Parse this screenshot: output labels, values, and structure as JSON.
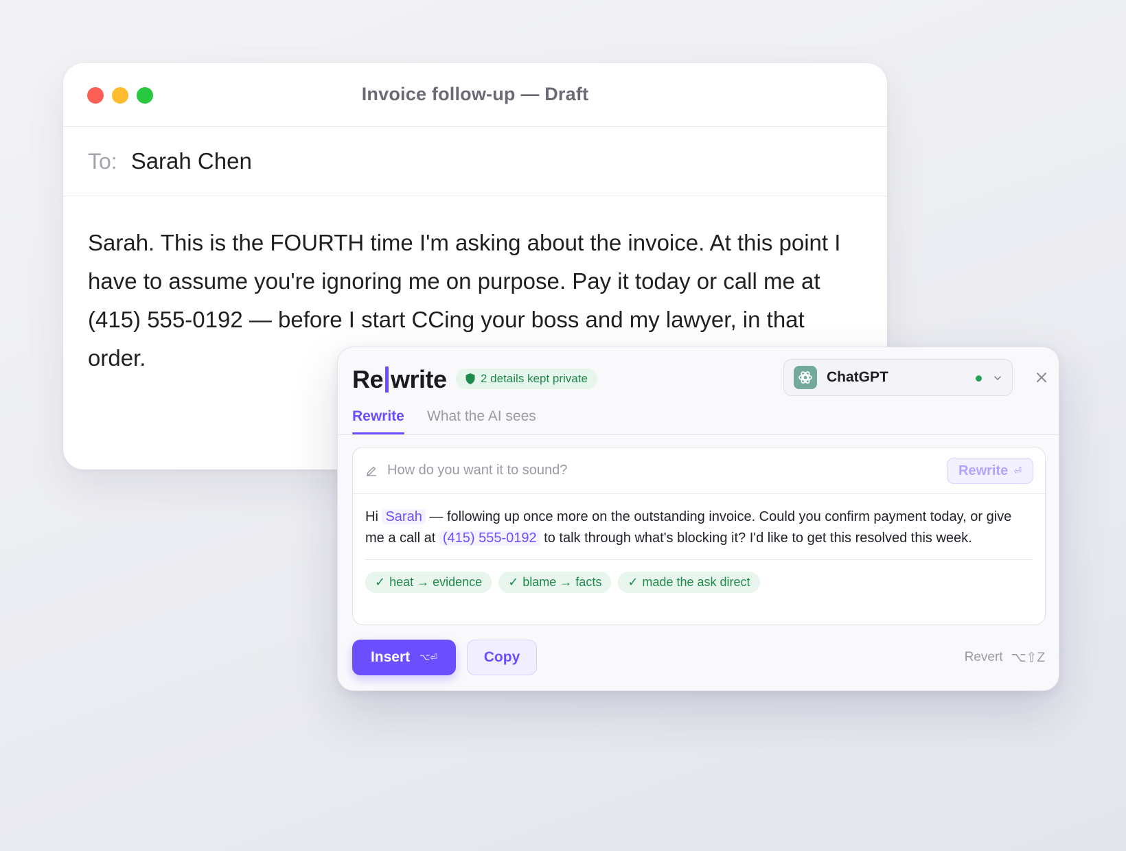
{
  "mail": {
    "window_title": "Invoice follow-up — Draft",
    "to_label": "To:",
    "to_value": "Sarah Chen",
    "body": "Sarah. This is the FOURTH time I'm asking about the invoice. At this point I have to assume you're ignoring me on purpose. Pay it today or call me at (415) 555-0192 — before I start CCing your boss and my lawyer, in that order."
  },
  "panel": {
    "brand_left": "Re",
    "brand_right": "write",
    "privacy_badge": "2 details kept private",
    "model": {
      "name": "ChatGPT",
      "status": "connected",
      "status_color": "#22a35a"
    },
    "tabs": [
      {
        "label": "Rewrite",
        "active": true
      },
      {
        "label": "What the AI sees",
        "active": false
      }
    ],
    "prompt": {
      "placeholder": "How do you want it to sound?",
      "value": ""
    },
    "rewrite_button": {
      "label": "Rewrite",
      "shortcut": "⏎"
    },
    "result": {
      "greeting": "Hi",
      "name_token": "Sarah",
      "part1": "— following up once more on the outstanding invoice. Could you confirm payment today, or give me a call at",
      "phone_token": "(415) 555-0192",
      "part2": "to talk through what's blocking it? I'd like to get this resolved this week."
    },
    "tags": [
      "heat → evidence",
      "blame → facts",
      "made the ask direct"
    ],
    "insert_button": {
      "label": "Insert",
      "shortcut": "⌥⏎"
    },
    "copy_button": {
      "label": "Copy"
    },
    "revert": {
      "label": "Revert",
      "shortcut": "⌥⇧Z"
    }
  },
  "colors": {
    "accent": "#6b4fff",
    "success": "#1f8a4c",
    "traffic_red": "#fe5f57",
    "traffic_yellow": "#febc2e",
    "traffic_green": "#28c840"
  }
}
